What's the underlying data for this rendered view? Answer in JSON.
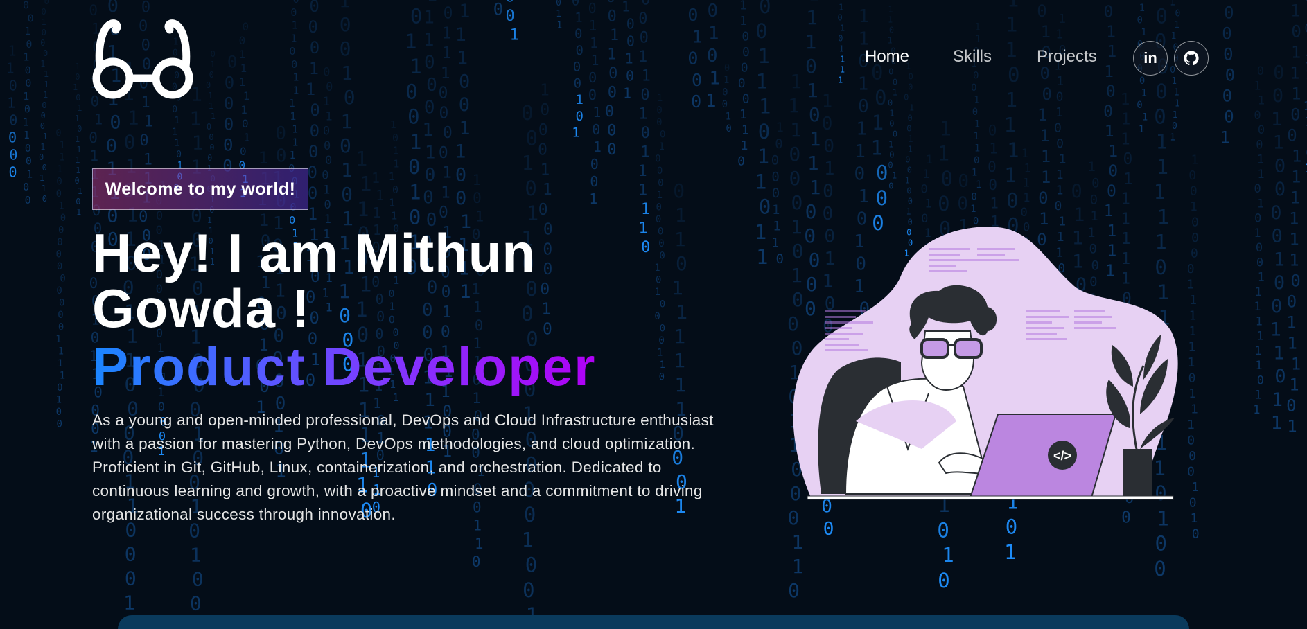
{
  "brand": {
    "logo_icon": "glasses-icon"
  },
  "nav": {
    "links": [
      {
        "label": "Home",
        "active": true
      },
      {
        "label": "Skills",
        "active": false
      },
      {
        "label": "Projects",
        "active": false
      }
    ],
    "social": [
      {
        "icon": "linkedin-icon",
        "glyph": "in"
      },
      {
        "icon": "github-icon"
      }
    ]
  },
  "hero": {
    "tagline": "Welcome to my world!",
    "title": "Hey! I am Mithun Gowda !",
    "role": "Product Developer",
    "description": "As a young and open-minded professional, DevOps and Cloud Infrastructure enthusiast with a passion for mastering Python, DevOps methodologies, and cloud optimization. Proficient in Git, GitHub, Linux, containerization, and orchestration. Dedicated to continuous learning and growth, with a proactive mindset and a commitment to driving organizational success through innovation.",
    "illustration_icon": "developer-at-laptop-illustration",
    "code_badge": "</>"
  },
  "colors": {
    "background": "#040d18",
    "rain_dim": "#0e3a6a",
    "rain_bright": "#1e90ff",
    "role_gradient_start": "#1a86ff",
    "role_gradient_end": "#b100f5",
    "illustration_blob": "#e7d1f3",
    "laptop": "#bb86e0"
  }
}
